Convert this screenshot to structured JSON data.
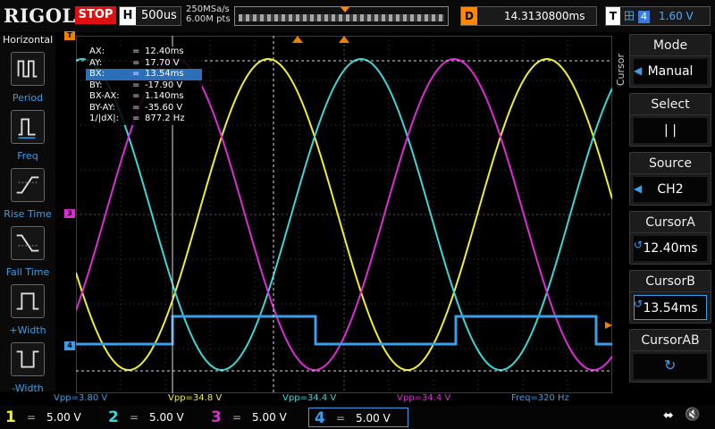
{
  "header": {
    "logo": "RIGOL",
    "status": "STOP",
    "timebase_label": "H",
    "timebase": "500us",
    "sample_rate": "250MSa/s",
    "memory_depth": "6.00M pts",
    "delay_label": "D",
    "delay": "14.3130800ms",
    "trigger_label": "T",
    "trigger_icon": "rising-edge-icon",
    "trigger_channel": "4",
    "trigger_level": "1.60 V"
  },
  "left_panel": {
    "title": "Horizontal",
    "items": [
      {
        "label": "Period",
        "icon": "period-icon"
      },
      {
        "label": "Freq",
        "icon": "freq-icon"
      },
      {
        "label": "Rise Time",
        "icon": "rise-time-icon"
      },
      {
        "label": "Fall Time",
        "icon": "fall-time-icon"
      },
      {
        "label": "+Width",
        "icon": "pos-width-icon"
      },
      {
        "label": "-Width",
        "icon": "neg-width-icon"
      }
    ]
  },
  "cursor_info": [
    {
      "key": "AX:",
      "eq": "=",
      "value": "12.40ms"
    },
    {
      "key": "AY:",
      "eq": "=",
      "value": "17.70 V"
    },
    {
      "key": "BX:",
      "eq": "=",
      "value": "13.54ms"
    },
    {
      "key": "BY:",
      "eq": "=",
      "value": "-17.90 V"
    },
    {
      "key": "BX-AX:",
      "eq": "=",
      "value": "1.140ms"
    },
    {
      "key": "BY-AY:",
      "eq": "=",
      "value": "-35.60 V"
    },
    {
      "key": "1/|dX|:",
      "eq": "=",
      "value": "877.2 Hz"
    }
  ],
  "channel_markers": {
    "ch3": "3",
    "ch4": "4"
  },
  "measurements": [
    {
      "text": "Vpp=3.80 V",
      "color": "#3a9ee8"
    },
    {
      "text": "Vpp=34.8 V",
      "color": "#f2ef2a"
    },
    {
      "text": "Vpp=34.4 V",
      "color": "#38d8d8"
    },
    {
      "text": "Vpp=34.4 V",
      "color": "#e02ad8"
    },
    {
      "text": "Freq=320 Hz",
      "color": "#3a9ee8"
    }
  ],
  "channels": [
    {
      "num": "1",
      "eq": "=",
      "scale": "5.00 V",
      "color": "#f2ef2a"
    },
    {
      "num": "2",
      "eq": "=",
      "scale": "5.00 V",
      "color": "#38d8d8"
    },
    {
      "num": "3",
      "eq": "=",
      "scale": "5.00 V",
      "color": "#e02ad8"
    },
    {
      "num": "4",
      "eq": "=",
      "scale": "5.00 V",
      "color": "#3a9ee8"
    }
  ],
  "right_panel": {
    "vertical_label": "Cursor",
    "buttons": [
      {
        "title": "Mode",
        "value": "Manual"
      },
      {
        "title": "Select",
        "value": "|   |"
      },
      {
        "title": "Source",
        "value": "CH2"
      },
      {
        "title": "CursorA",
        "value": "12.40ms"
      },
      {
        "title": "CursorB",
        "value": "13.54ms"
      },
      {
        "title": "CursorAB",
        "value": ""
      }
    ]
  },
  "colors": {
    "ch1": "#f2ef2a",
    "ch2": "#38d8d8",
    "ch3": "#e02ad8",
    "ch4": "#3a9ee8",
    "accent": "#f08000"
  }
}
